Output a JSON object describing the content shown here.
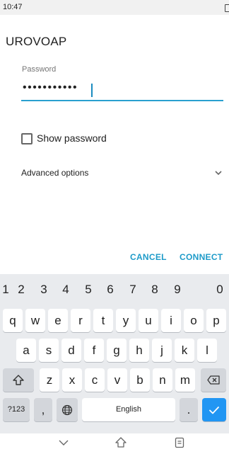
{
  "status_bar": {
    "time": "10:47"
  },
  "dialog": {
    "title": "UROVOAP",
    "password_label": "Password",
    "password_mask": "•••••••••••",
    "show_password_label": "Show password",
    "show_password_checked": false,
    "advanced_label": "Advanced options",
    "cancel_label": "CANCEL",
    "connect_label": "CONNECT"
  },
  "colors": {
    "accent": "#1e9bc9",
    "keyboard_bg": "#e9ebee",
    "enter_key": "#2196f3"
  },
  "keyboard": {
    "number_row": [
      "1",
      "2",
      "3",
      "4",
      "5",
      "6",
      "7",
      "8",
      "9",
      "0"
    ],
    "row1": [
      "q",
      "w",
      "e",
      "r",
      "t",
      "y",
      "u",
      "i",
      "o",
      "p"
    ],
    "row2": [
      "a",
      "s",
      "d",
      "f",
      "g",
      "h",
      "j",
      "k",
      "l"
    ],
    "row3": [
      "z",
      "x",
      "c",
      "v",
      "b",
      "n",
      "m"
    ],
    "symbols_label": "?123",
    "comma_label": ",",
    "space_label": "English",
    "period_label": ".",
    "icons": {
      "shift": "shift-icon",
      "backspace": "backspace-icon",
      "globe": "globe-icon",
      "enter": "checkmark-icon"
    }
  },
  "nav_bar": {
    "icons": [
      "chevron-down-icon",
      "home-icon",
      "recents-icon"
    ]
  }
}
